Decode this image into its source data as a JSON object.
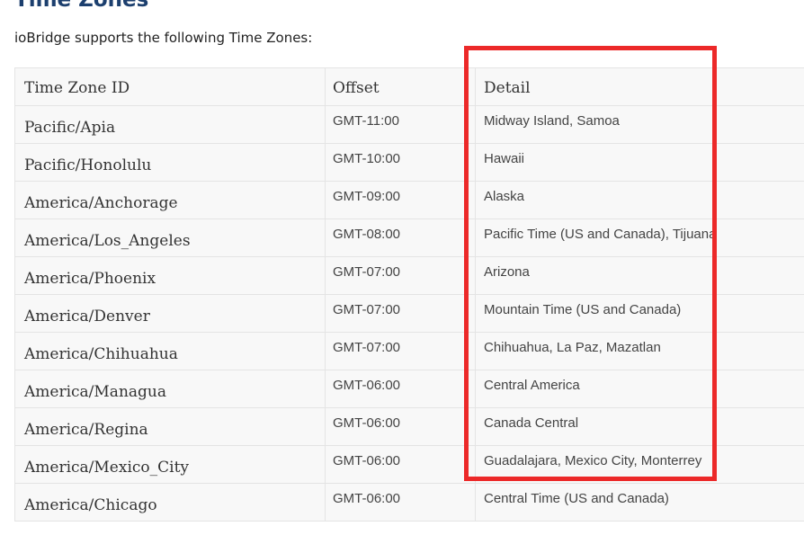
{
  "page": {
    "title": "Time Zones",
    "intro": "ioBridge supports the following Time Zones:"
  },
  "table": {
    "headers": [
      "Time Zone ID",
      "Offset",
      "Detail"
    ],
    "rows": [
      [
        "Pacific/Apia",
        "GMT-11:00",
        "Midway Island, Samoa"
      ],
      [
        "Pacific/Honolulu",
        "GMT-10:00",
        "Hawaii"
      ],
      [
        "America/Anchorage",
        "GMT-09:00",
        "Alaska"
      ],
      [
        "America/Los_Angeles",
        "GMT-08:00",
        "Pacific Time (US and Canada), Tijuana"
      ],
      [
        "America/Phoenix",
        "GMT-07:00",
        "Arizona"
      ],
      [
        "America/Denver",
        "GMT-07:00",
        "Mountain Time (US and Canada)"
      ],
      [
        "America/Chihuahua",
        "GMT-07:00",
        "Chihuahua, La Paz, Mazatlan"
      ],
      [
        "America/Managua",
        "GMT-06:00",
        "Central America"
      ],
      [
        "America/Regina",
        "GMT-06:00",
        "Canada Central"
      ],
      [
        "America/Mexico_City",
        "GMT-06:00",
        "Guadalajara, Mexico City, Monterrey"
      ],
      [
        "America/Chicago",
        "GMT-06:00",
        "Central Time (US and Canada)"
      ]
    ]
  },
  "colors": {
    "title": "#1c3f6e",
    "highlight_box": "#ec2929",
    "table_background": "#f8f8f8",
    "table_border": "#e4e4e4"
  }
}
